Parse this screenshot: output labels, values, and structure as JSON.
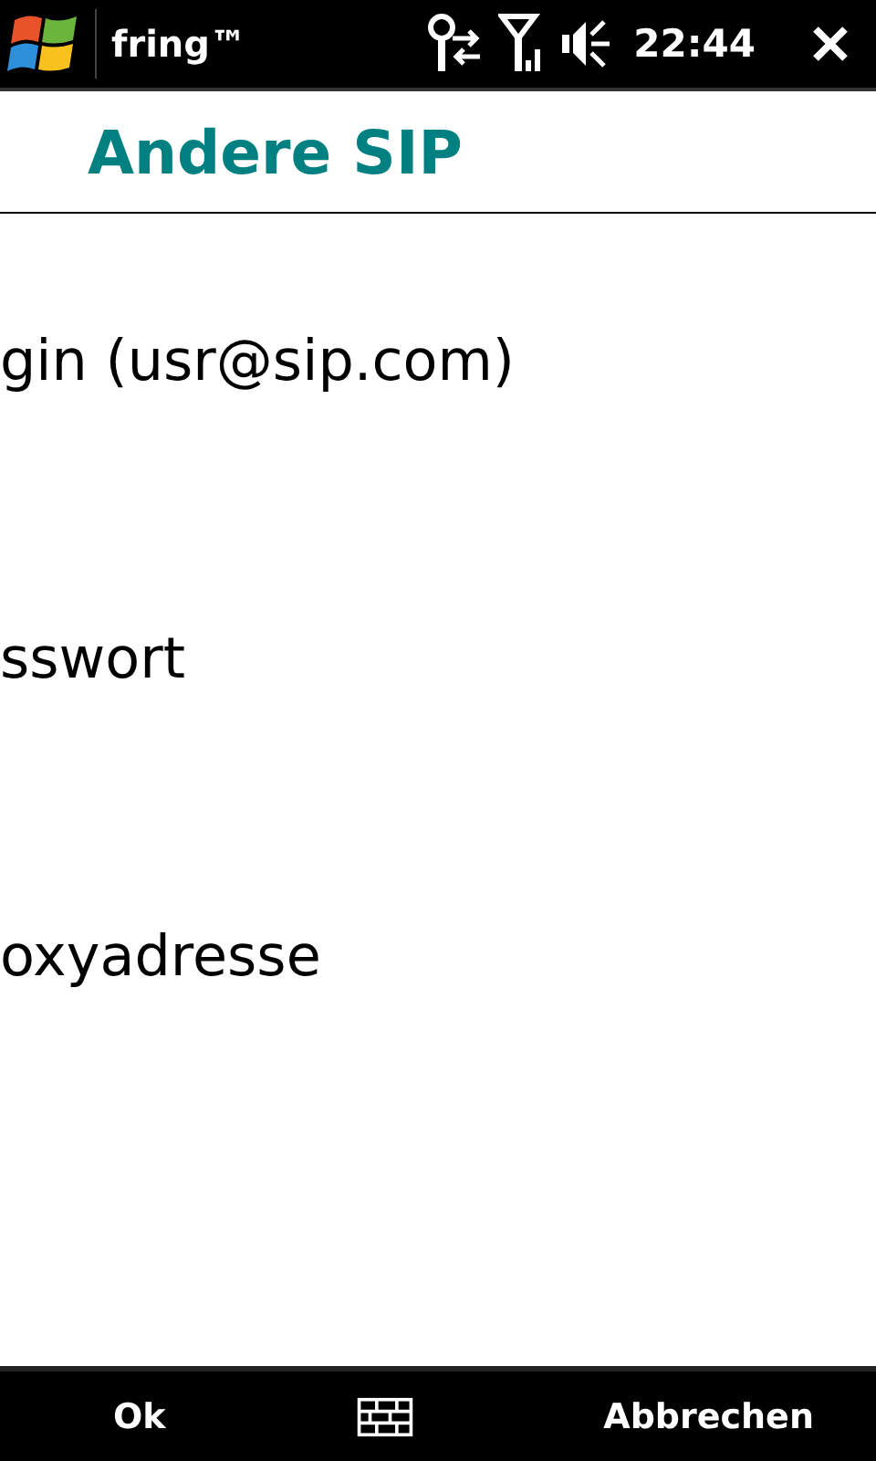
{
  "status_bar": {
    "app_title": "fring™",
    "time": "22:44"
  },
  "header": {
    "title": "Andere SIP"
  },
  "fields": [
    {
      "label": "gin (usr@sip.com)"
    },
    {
      "label": "sswort"
    },
    {
      "label": "oxyadresse"
    }
  ],
  "softkeys": {
    "left": "Ok",
    "right": "Abbrechen"
  }
}
